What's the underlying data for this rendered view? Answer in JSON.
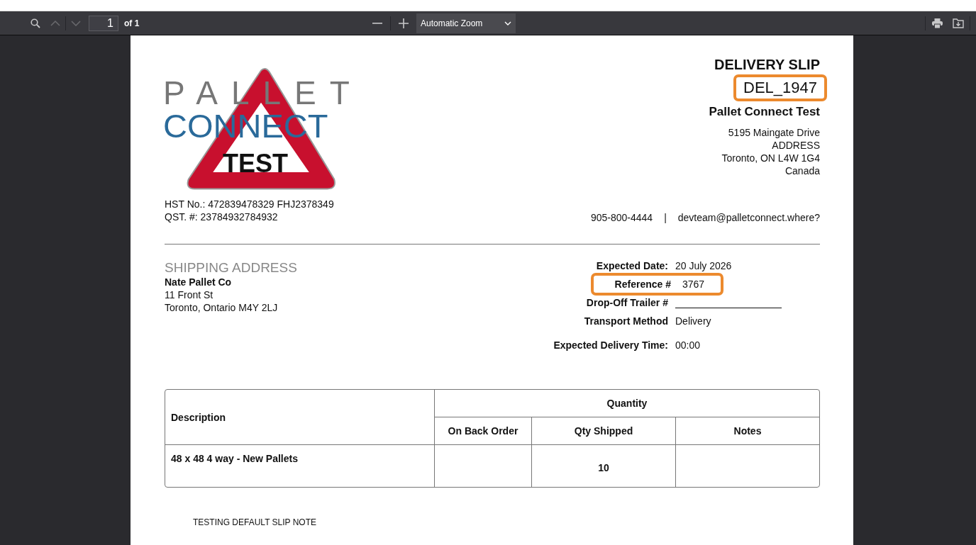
{
  "toolbar": {
    "page_number": "1",
    "page_count": "of 1",
    "zoom": "Automatic Zoom"
  },
  "logo": {
    "top": "PALLET",
    "middle": "CONNECT",
    "sign": "TEST"
  },
  "header": {
    "title": "DELIVERY SLIP",
    "number": {
      "text": "DEL_1947",
      "highlighted": true
    },
    "company": "Pallet Connect Test",
    "address": [
      "5195 Maingate Drive",
      "ADDRESS",
      "Toronto, ON L4W 1G4",
      "Canada"
    ]
  },
  "tax_lines": [
    "HST No.: 472839478329 FHJ2378349",
    "QST. #: 23784932784932"
  ],
  "contact": {
    "phone": "905-800-4444",
    "separator": "|",
    "email": "devteam@palletconnect.where?"
  },
  "shipping": {
    "heading": "SHIPPING ADDRESS",
    "name": "Nate Pallet Co",
    "lines": [
      "11 Front St",
      "Toronto, Ontario M4Y 2LJ"
    ]
  },
  "details": [
    {
      "kind": "text",
      "label": "Expected Date:",
      "value": "20 July 2026",
      "highlighted": false
    },
    {
      "kind": "text",
      "label": "Reference #",
      "value": "3767",
      "highlighted": true
    },
    {
      "kind": "blank",
      "label": "Drop-Off Trailer #",
      "highlighted": false
    },
    {
      "kind": "text",
      "label": "Transport Method",
      "value": "Delivery",
      "highlighted": false
    },
    {
      "kind": "text",
      "label": "Expected Delivery Time:",
      "value": "00:00",
      "highlighted": false
    }
  ],
  "table": {
    "description_heading": "Description",
    "group_heading": "Quantity",
    "columns": [
      "On Back Order",
      "Qty Shipped",
      "Notes"
    ],
    "rows": [
      {
        "description": "48 x 48 4 way - New Pallets",
        "cells": [
          "",
          "10",
          ""
        ]
      }
    ]
  },
  "note": "TESTING DEFAULT SLIP NOTE"
}
